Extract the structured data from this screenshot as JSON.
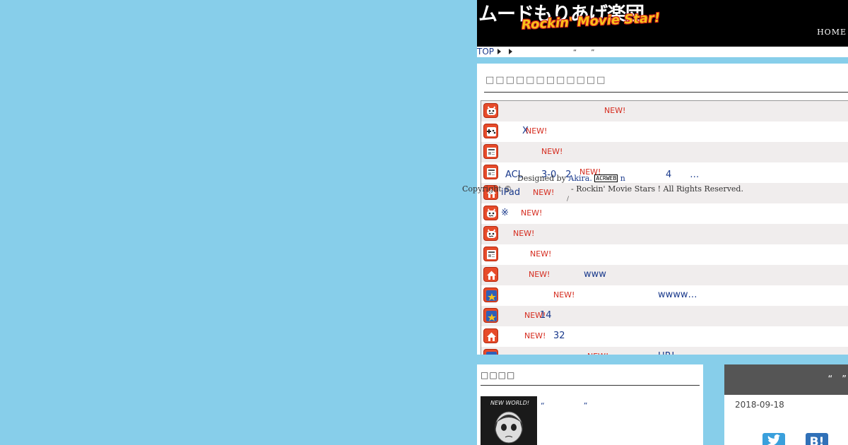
{
  "header": {
    "title": "ムードもりあげ楽団",
    "subtitle": "Rockin' Movie Star!",
    "home": "HOME"
  },
  "breadcrumb": {
    "top": "TOP",
    "current": "“　　”"
  },
  "news": {
    "title": "□□□□□□□□□□□□",
    "new_label": "NEW!",
    "rows": [
      {
        "icon": "monster-icon",
        "text": "",
        "extra": ""
      },
      {
        "icon": "gamepad-icon",
        "text": "X",
        "extra": ""
      },
      {
        "icon": "news-icon",
        "text": "",
        "extra": ""
      },
      {
        "icon": "news-icon",
        "text": "ACL　　3-0　2",
        "extra": "4　　…"
      },
      {
        "icon": "home-icon",
        "text": "iPad",
        "extra": ""
      },
      {
        "icon": "monster-icon",
        "text": "※",
        "extra": ""
      },
      {
        "icon": "monster-icon",
        "text": "",
        "extra": ""
      },
      {
        "icon": "news-icon",
        "text": "",
        "extra": ""
      },
      {
        "icon": "home-icon",
        "text": "",
        "extra": "www"
      },
      {
        "icon": "star-icon",
        "text": "",
        "extra": "wwww…"
      },
      {
        "icon": "star-icon",
        "text": "",
        "extra": "14"
      },
      {
        "icon": "home-icon",
        "text": "",
        "extra": "32"
      },
      {
        "icon": "star-icon",
        "text": "",
        "extra": "HR!"
      }
    ]
  },
  "footer": {
    "designed_by": "Designed by",
    "author": "Akira.",
    "badge": "ACRWEB",
    "after_badge": "n",
    "copyright_left": "Copyright ©",
    "copyright_right": "- Rockin' Movie Stars ! All Rights Reserved.",
    "slash": "/"
  },
  "sidebar_left": {
    "title": "□□□□",
    "thumb_text": "NEW WORLD!",
    "link": "“　　　　　”"
  },
  "sidebar_right": {
    "head": "“　”",
    "date": "2018-09-18"
  },
  "colors": {
    "background": "#87ceea",
    "link": "#1a3a8c",
    "new": "#d52b1e",
    "icon": "#e64b2a"
  }
}
